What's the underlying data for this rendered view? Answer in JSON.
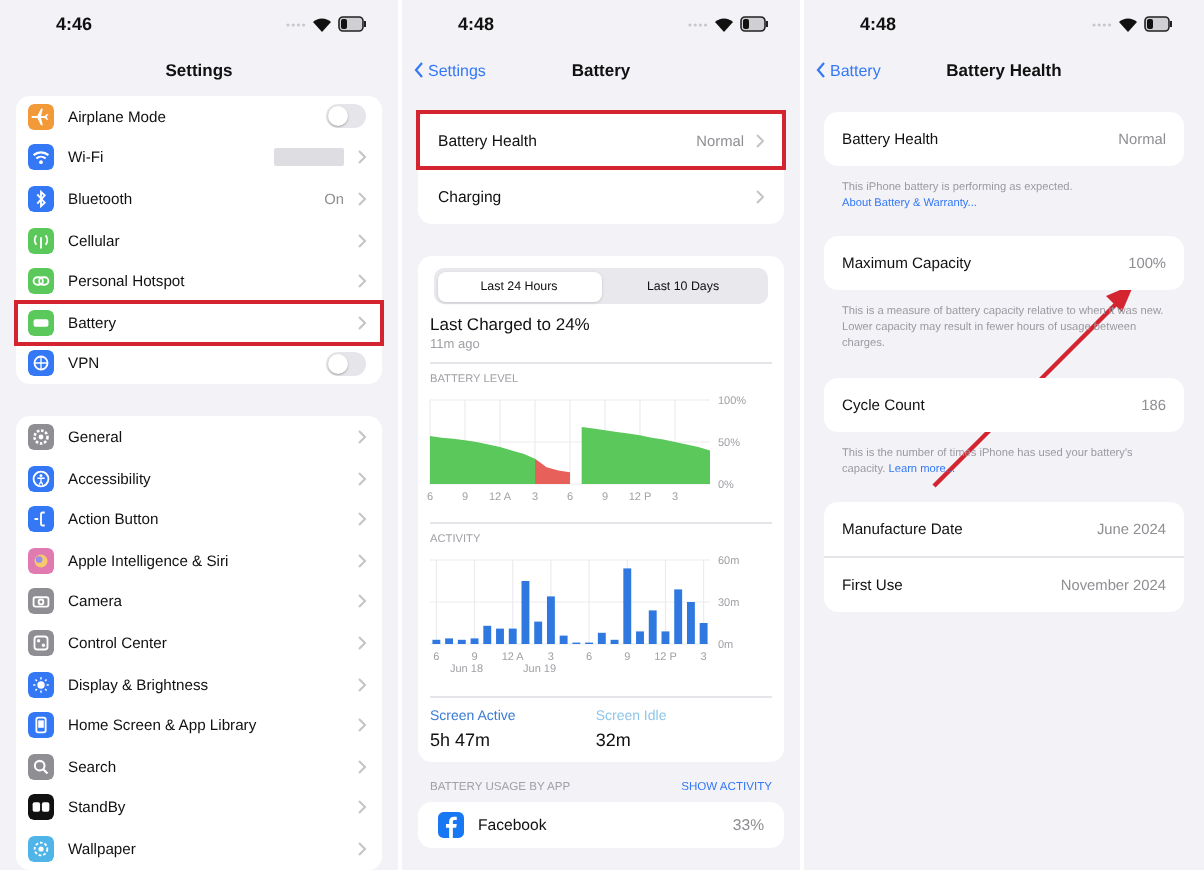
{
  "panels": [
    {
      "kind": "settings",
      "time": "4:46",
      "title": "Settings",
      "groups": [
        {
          "rows": [
            {
              "label": "Airplane Mode",
              "kind": "toggle",
              "on": false,
              "highlighted": false,
              "color": "#f19a37"
            },
            {
              "label": "Wi-Fi",
              "kind": "masked",
              "highlighted": false,
              "color": "#3478f6"
            },
            {
              "label": "Bluetooth",
              "value": "On",
              "kind": "link",
              "highlighted": false,
              "color": "#3478f6"
            },
            {
              "label": "Cellular",
              "kind": "link",
              "highlighted": false,
              "color": "#5ac85a"
            },
            {
              "label": "Personal Hotspot",
              "kind": "link",
              "highlighted": false,
              "color": "#5ac85a"
            },
            {
              "label": "Battery",
              "kind": "link",
              "highlighted": true,
              "color": "#5ac85a"
            },
            {
              "label": "VPN",
              "kind": "toggle",
              "on": false,
              "highlighted": false,
              "color": "#3478f6"
            }
          ]
        },
        {
          "rows": [
            {
              "label": "General",
              "kind": "link",
              "highlighted": false,
              "color": "#8e8e93"
            },
            {
              "label": "Accessibility",
              "kind": "link",
              "highlighted": false,
              "color": "#3478f6"
            },
            {
              "label": "Action Button",
              "kind": "link",
              "highlighted": false,
              "color": "#3478f6"
            },
            {
              "label": "Apple Intelligence & Siri",
              "kind": "link",
              "highlighted": false,
              "color": "#e07ab0"
            },
            {
              "label": "Camera",
              "kind": "link",
              "highlighted": false,
              "color": "#8e8e93"
            },
            {
              "label": "Control Center",
              "kind": "link",
              "highlighted": false,
              "color": "#8e8e93"
            },
            {
              "label": "Display & Brightness",
              "kind": "link",
              "highlighted": false,
              "color": "#3478f6"
            },
            {
              "label": "Home Screen & App Library",
              "kind": "link",
              "highlighted": false,
              "color": "#3478f6"
            },
            {
              "label": "Search",
              "kind": "link",
              "highlighted": false,
              "color": "#8e8e93"
            },
            {
              "label": "StandBy",
              "kind": "link",
              "highlighted": false,
              "color": "#111111"
            },
            {
              "label": "Wallpaper",
              "kind": "link",
              "highlighted": false,
              "color": "#4fb4e8"
            }
          ]
        }
      ]
    },
    {
      "kind": "battery",
      "time": "4:48",
      "back": "Settings",
      "title": "Battery",
      "rows": [
        {
          "label": "Battery Health",
          "value": "Normal",
          "highlighted": true
        },
        {
          "label": "Charging",
          "highlighted": false
        }
      ],
      "segments": [
        {
          "label": "Last 24 Hours",
          "selected": true
        },
        {
          "label": "Last 10 Days",
          "selected": false
        }
      ],
      "last_charged": "Last Charged to 24%",
      "last_charged_time": "11m ago",
      "battery_level": {
        "title": "BATTERY LEVEL",
        "chart_data": {
          "type": "area",
          "categories": [
            "6",
            null,
            null,
            "9",
            null,
            null,
            "12 A",
            null,
            null,
            "3",
            null,
            null,
            "6",
            null,
            null,
            "9",
            null,
            null,
            "12 P",
            null,
            null,
            "3",
            null,
            null,
            null
          ],
          "series": [
            {
              "color": "#5ac85a",
              "values": [
                57,
                55,
                54,
                52,
                50,
                47,
                44,
                40,
                36,
                30,
                null,
                null,
                null,
                68,
                66,
                64,
                62,
                60,
                58,
                55,
                53,
                50,
                47,
                44,
                40
              ]
            },
            {
              "color": "#e8605a",
              "values": [
                null,
                null,
                null,
                null,
                null,
                null,
                null,
                null,
                null,
                30,
                20,
                16,
                14,
                null,
                null,
                null,
                null,
                null,
                null,
                null,
                null,
                null,
                null,
                null,
                null
              ]
            }
          ],
          "ylim": [
            0,
            100
          ],
          "grid": true,
          "yticks": [
            {
              "value": 0,
              "label": "0%"
            },
            {
              "value": 50,
              "label": "50%"
            },
            {
              "value": 100,
              "label": "100%"
            }
          ]
        }
      },
      "activity": {
        "title": "ACTIVITY",
        "chart_data": {
          "type": "bar",
          "categories": [
            "6",
            null,
            null,
            "9",
            null,
            null,
            "12 A",
            null,
            null,
            "3",
            null,
            null,
            "6",
            null,
            null,
            "9",
            null,
            null,
            "12 P",
            null,
            null,
            "3"
          ],
          "series": [
            {
              "color": "#2f78e0",
              "values": [
                3,
                4,
                3,
                4,
                13,
                11,
                11,
                45,
                16,
                34,
                6,
                1,
                1,
                8,
                3,
                54,
                9,
                24,
                9,
                39,
                30,
                15
              ]
            }
          ],
          "ylim": [
            0,
            60
          ],
          "grid": true,
          "yticks": [
            {
              "value": 0,
              "label": "0m"
            },
            {
              "value": 30,
              "label": "30m"
            },
            {
              "value": 60,
              "label": "60m"
            }
          ]
        },
        "dates": [
          "Jun 18",
          "Jun 19"
        ]
      },
      "stats": [
        {
          "label": "Screen Active",
          "value": "5h 47m",
          "color": "#3a7bd5"
        },
        {
          "label": "Screen Idle",
          "value": "32m",
          "color": "#8ec6e8"
        }
      ],
      "usage": {
        "title": "BATTERY USAGE BY APP",
        "action": "SHOW ACTIVITY",
        "apps": [
          {
            "name": "Facebook",
            "percent": "33%"
          }
        ]
      }
    },
    {
      "kind": "health",
      "time": "4:48",
      "back": "Battery",
      "title": "Battery Health",
      "sections": [
        {
          "rows": [
            {
              "label": "Battery Health",
              "value": "Normal"
            }
          ],
          "footnote": "This iPhone battery is performing as expected.",
          "link": "About Battery & Warranty..."
        },
        {
          "rows": [
            {
              "label": "Maximum Capacity",
              "value": "100%"
            }
          ],
          "footnote": "This is a measure of battery capacity relative to when it was new. Lower capacity may result in fewer hours of usage between charges."
        },
        {
          "rows": [
            {
              "label": "Cycle Count",
              "value": "186"
            }
          ],
          "footnote": "This is the number of times iPhone has used your battery's capacity.",
          "link": "Learn more..."
        },
        {
          "rows": [
            {
              "label": "Manufacture Date",
              "value": "June 2024"
            },
            {
              "label": "First Use",
              "value": "November 2024"
            }
          ]
        }
      ]
    }
  ]
}
